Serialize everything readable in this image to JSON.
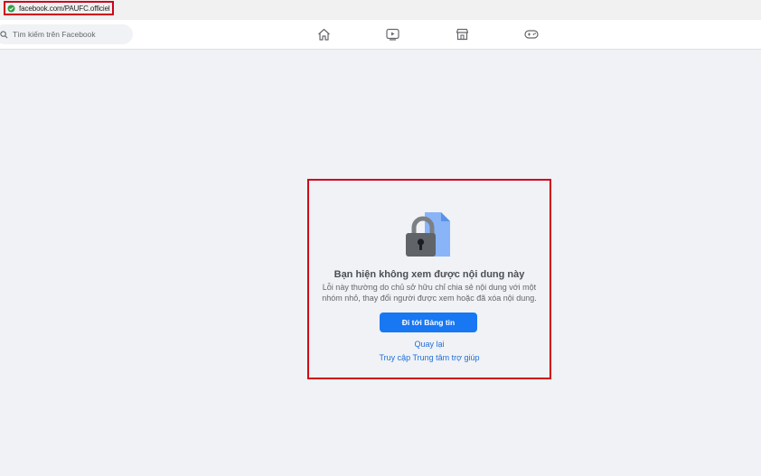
{
  "browser": {
    "url": "facebook.com/PAUFC.officiel"
  },
  "header": {
    "search_placeholder": "Tìm kiếm trên Facebook",
    "nav_icons": [
      "home-icon",
      "video-icon",
      "marketplace-icon",
      "gaming-icon"
    ]
  },
  "content": {
    "illustration": "lock-document-icon",
    "title": "Bạn hiện không xem được nội dung này",
    "description_line1": "Lỗi này thường do chủ sở hữu chỉ chia sẻ nội dung với một",
    "description_line2": "nhóm nhỏ, thay đổi người được xem hoặc đã xóa nội dung.",
    "primary_button": "Đi tới Bảng tin",
    "back_link": "Quay lại",
    "help_link": "Truy cập Trung tâm trợ giúp"
  },
  "colors": {
    "accent": "#1877f2",
    "link": "#216fdb",
    "highlight_border": "#d0021b",
    "background": "#f0f2f5"
  }
}
